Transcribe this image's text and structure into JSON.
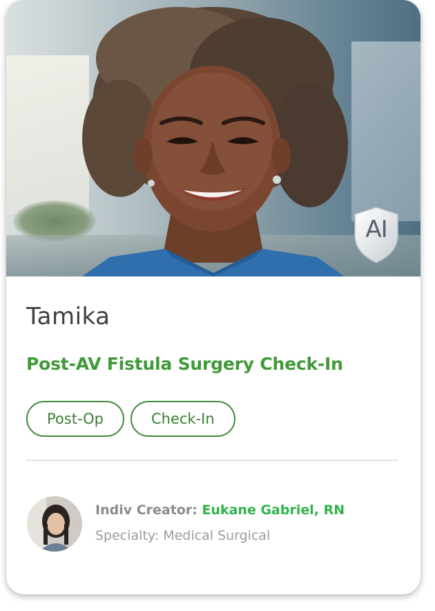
{
  "card": {
    "name": "Tamika",
    "title": "Post-AV Fistula Surgery Check-In",
    "badge": "AI",
    "tags": [
      "Post-Op",
      "Check-In"
    ],
    "creator_label": "Indiv Creator:",
    "creator_name": "Eukane Gabriel, RN",
    "specialty": "Specialty: Medical Surgical"
  },
  "colors": {
    "accent_green": "#3f9a37",
    "creator_green": "#2fb24b",
    "tag_border": "#3c8a36",
    "scrub_blue": "#2f6fae"
  },
  "icons": {
    "badge": "ai-shield-icon"
  }
}
